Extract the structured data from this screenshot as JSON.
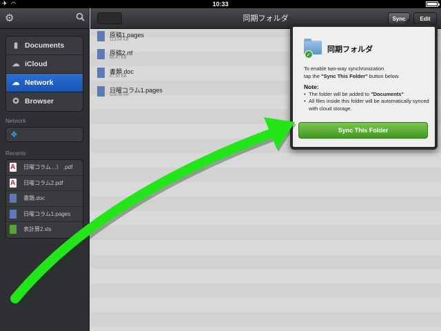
{
  "status_bar": {
    "time": "10:33"
  },
  "sidebar": {
    "nav_items": [
      {
        "label": "Documents",
        "icon": "document-icon"
      },
      {
        "label": "iCloud",
        "icon": "cloud-icon"
      },
      {
        "label": "Network",
        "icon": "cloud-upload-icon",
        "active": true
      },
      {
        "label": "Browser",
        "icon": "compass-icon"
      }
    ],
    "network_label": "Network",
    "recents_label": "Recents",
    "recents": [
      {
        "label": "日曜コラム…） .pdf",
        "type": "pdf"
      },
      {
        "label": "日曜コラム2.pdf",
        "type": "pdf"
      },
      {
        "label": "書類.doc",
        "type": "pages"
      },
      {
        "label": "日曜コラム1.pages",
        "type": "pages"
      },
      {
        "label": "表計算2.xls",
        "type": "xls"
      }
    ]
  },
  "main": {
    "title": "同期フォルダ",
    "sync_label": "Sync",
    "edit_label": "Edit",
    "files": [
      {
        "name": "原稿1.pages",
        "size": "113.04 KB"
      },
      {
        "name": "原稿2.rtf",
        "size": "88.47 KB"
      },
      {
        "name": "書類.doc",
        "size": "97.50 KB"
      },
      {
        "name": "日曜コラム1.pages",
        "size": "526.05 KB"
      }
    ]
  },
  "popover": {
    "title": "同期フォルダ",
    "intro_1": "To enable two-way synchronization",
    "intro_2_pre": "tap the ",
    "intro_2_bold": "\"Sync This Folder\"",
    "intro_2_post": " button below.",
    "note_label": "Note:",
    "bullet_1_pre": "The folder will be added to ",
    "bullet_1_bold": "\"Documents\"",
    "bullet_2": "All files inside this folder will be automatically synced with cloud storage.",
    "button_label": "Sync This Folder"
  },
  "colors": {
    "accent_blue": "#2b6fd3",
    "sync_green": "#4fae2e",
    "arrow_green": "#22e61a"
  }
}
